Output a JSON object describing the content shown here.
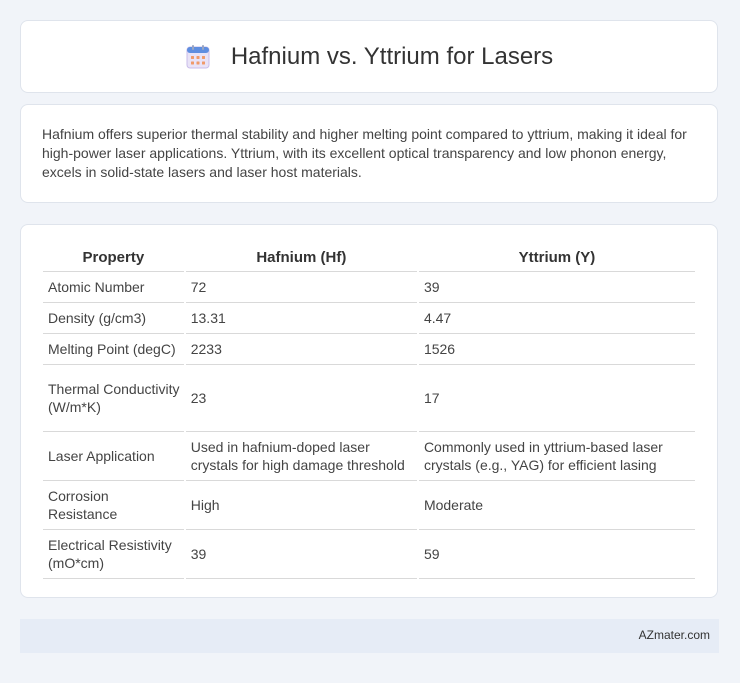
{
  "header": {
    "title": "Hafnium vs. Yttrium for Lasers",
    "icon": "calendar-icon"
  },
  "intro": {
    "text": "Hafnium offers superior thermal stability and higher melting point compared to yttrium, making it ideal for high-power laser applications. Yttrium, with its excellent optical transparency and low phonon energy, excels in solid-state lasers and laser host materials."
  },
  "table": {
    "headers": [
      "Property",
      "Hafnium (Hf)",
      "Yttrium (Y)"
    ],
    "rows": [
      [
        "Atomic Number",
        "72",
        "39"
      ],
      [
        "Density (g/cm3)",
        "13.31",
        "4.47"
      ],
      [
        "Melting Point (degC)",
        "2233",
        "1526"
      ],
      [
        "Thermal Conductivity (W/m*K)",
        "23",
        "17"
      ],
      [
        "Laser Application",
        "Used in hafnium-doped laser crystals for high damage threshold",
        "Commonly used in yttrium-based laser crystals (e.g., YAG) for efficient lasing"
      ],
      [
        "Corrosion Resistance",
        "High",
        "Moderate"
      ],
      [
        "Electrical Resistivity (mO*cm)",
        "39",
        "59"
      ]
    ]
  },
  "footer": {
    "brand": "AZmater.com"
  }
}
